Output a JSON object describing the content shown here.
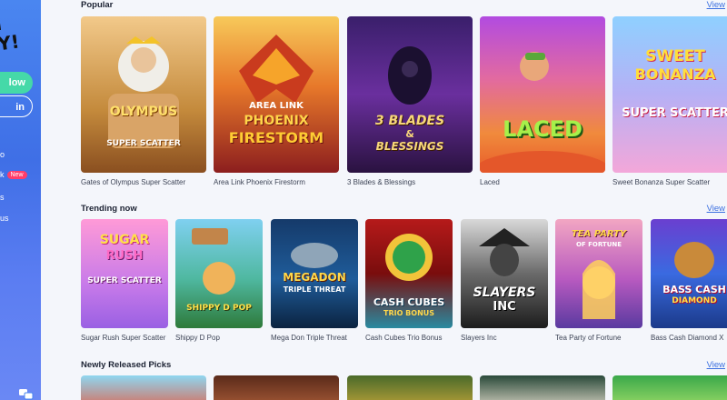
{
  "sidebar": {
    "logo": "I\nY!",
    "primary_button": "low",
    "secondary_button": "in",
    "links": [
      {
        "label": "o",
        "badge": ""
      },
      {
        "label": "k",
        "badge": "New"
      },
      {
        "label": "s",
        "badge": ""
      },
      {
        "label": "us",
        "badge": ""
      }
    ]
  },
  "sections": [
    {
      "title": "Popular",
      "view_label": "View",
      "games": [
        {
          "name": "Gates of Olympus Super Scatter",
          "art_lines": [
            "GATES OF",
            "OLYMPUS",
            "SUPER SCATTER"
          ]
        },
        {
          "name": "Area Link Phoenix Firestorm",
          "art_lines": [
            "AREA LINK",
            "PHOENIX",
            "FIRESTORM"
          ]
        },
        {
          "name": "3 Blades & Blessings",
          "art_lines": [
            "3 BLADES",
            "&",
            "BLESSINGS"
          ]
        },
        {
          "name": "Laced",
          "art_lines": [
            "LACED"
          ]
        },
        {
          "name": "Sweet Bonanza Super Scatter",
          "art_lines": [
            "SWEET",
            "BONANZA",
            "SUPER SCATTER"
          ]
        }
      ]
    },
    {
      "title": "Trending now",
      "view_label": "View",
      "games": [
        {
          "name": "Sugar Rush Super Scatter",
          "art_lines": [
            "SUGAR",
            "RUSH",
            "SUPER SCATTER"
          ]
        },
        {
          "name": "Shippy D Pop",
          "art_lines": [
            "SHIPPY D POP"
          ]
        },
        {
          "name": "Mega Don Triple Threat",
          "art_lines": [
            "MEGADON",
            "TRIPLE THREAT"
          ]
        },
        {
          "name": "Cash Cubes Trio Bonus",
          "art_lines": [
            "CASH CUBES",
            "TRIO BONUS"
          ]
        },
        {
          "name": "Slayers Inc",
          "art_lines": [
            "SLAYERS",
            "INC"
          ]
        },
        {
          "name": "Tea Party of Fortune",
          "art_lines": [
            "TEA PARTY",
            "OF FORTUNE"
          ]
        },
        {
          "name": "Bass Cash Diamond X",
          "art_lines": [
            "BASS CASH",
            "DIAMOND"
          ]
        }
      ]
    },
    {
      "title": "Newly Released Picks",
      "view_label": "View",
      "games": []
    }
  ],
  "colors": {
    "accent": "#3b6fe0",
    "primary_button": "#45d9a8",
    "badge": "#ff3d6a"
  }
}
